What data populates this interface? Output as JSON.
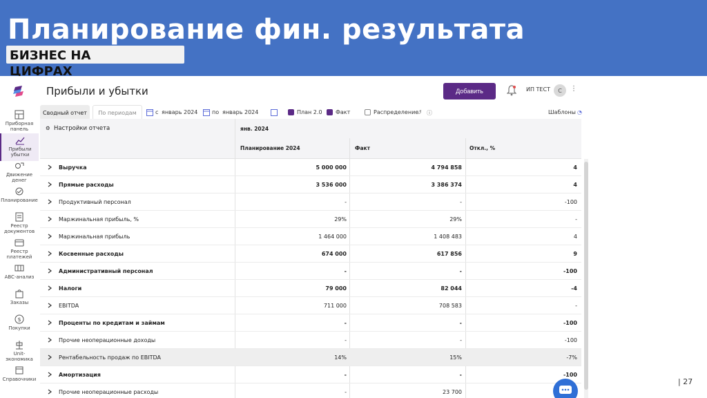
{
  "slide": {
    "title": "Планирование фин. результата",
    "badge": "БИЗНЕС НА ЦИФРАХ",
    "page_number": "| 27"
  },
  "colors": {
    "banner": "#4472c4",
    "accent": "#5b2a86",
    "chat": "#2f6fd6"
  },
  "app": {
    "page_title": "Прибыли и убытки",
    "add_button": "Добавить",
    "user_name": "ИП ТЕСТ",
    "avatar_letter": "С",
    "more": "⋮"
  },
  "sidebar": {
    "items": [
      {
        "label": "Приборная панель",
        "icon": "dashboard-icon",
        "active": false
      },
      {
        "label": "Прибыли убытки",
        "icon": "chart-icon",
        "active": true
      },
      {
        "label": "Движение денег",
        "icon": "money-flow-icon",
        "active": false
      },
      {
        "label": "Планирование",
        "icon": "planning-icon",
        "active": false
      },
      {
        "label": "Реестр документов",
        "icon": "document-icon",
        "active": false
      },
      {
        "label": "Реестр платежей",
        "icon": "wallet-icon",
        "active": false
      },
      {
        "label": "ABC-анализ",
        "icon": "abc-icon",
        "active": false
      },
      {
        "label": "Заказы",
        "icon": "bag-icon",
        "active": false
      },
      {
        "label": "Покупки",
        "icon": "dollar-icon",
        "active": false
      },
      {
        "label": "Unit-экономика",
        "icon": "unit-icon",
        "active": false
      },
      {
        "label": "Справочники",
        "icon": "book-icon",
        "active": false
      }
    ]
  },
  "toolbar": {
    "tab_summary": "Сводный отчет",
    "tab_periods": "По периодам",
    "from_label": "с",
    "from_date": "январь 2024",
    "to_label": "по",
    "to_date": "январь 2024",
    "plan_label": "План 2.0",
    "fact_label": "Факт",
    "distribution_label": "Распределение",
    "templates_label": "Шаблоны"
  },
  "table": {
    "settings_label": "Настройки отчета",
    "period_header": "янв. 2024",
    "columns": [
      "Планирование 2024",
      "Факт",
      "Откл., %"
    ],
    "rows": [
      {
        "name": "Выручка",
        "plan": "5 000 000",
        "fact": "4 794 858",
        "dev": "4",
        "bold": true,
        "shaded": false
      },
      {
        "name": "Прямые расходы",
        "plan": "3 536 000",
        "fact": "3 386 374",
        "dev": "4",
        "bold": true,
        "shaded": false
      },
      {
        "name": "Продуктивный персонал",
        "plan": "-",
        "fact": "-",
        "dev": "-100",
        "bold": false,
        "shaded": false
      },
      {
        "name": "Маржинальная прибыль, %",
        "plan": "29%",
        "fact": "29%",
        "dev": "-",
        "bold": false,
        "shaded": false
      },
      {
        "name": "Маржинальная прибыль",
        "plan": "1 464 000",
        "fact": "1 408 483",
        "dev": "4",
        "bold": false,
        "shaded": false
      },
      {
        "name": "Косвенные расходы",
        "plan": "674 000",
        "fact": "617 856",
        "dev": "9",
        "bold": true,
        "shaded": false
      },
      {
        "name": "Административный персонал",
        "plan": "-",
        "fact": "-",
        "dev": "-100",
        "bold": true,
        "shaded": false
      },
      {
        "name": "Налоги",
        "plan": "79 000",
        "fact": "82 044",
        "dev": "-4",
        "bold": true,
        "shaded": false
      },
      {
        "name": "EBITDA",
        "plan": "711 000",
        "fact": "708 583",
        "dev": "-",
        "bold": false,
        "shaded": false
      },
      {
        "name": "Проценты по кредитам и займам",
        "plan": "-",
        "fact": "-",
        "dev": "-100",
        "bold": true,
        "shaded": false
      },
      {
        "name": "Прочие неоперационные доходы",
        "plan": "-",
        "fact": "-",
        "dev": "-100",
        "bold": false,
        "shaded": false
      },
      {
        "name": "Рентабельность продаж по EBITDA",
        "plan": "14%",
        "fact": "15%",
        "dev": "-7%",
        "bold": false,
        "shaded": true
      },
      {
        "name": "Амортизация",
        "plan": "-",
        "fact": "-",
        "dev": "-100",
        "bold": true,
        "shaded": false
      },
      {
        "name": "Прочие неоперационные расходы",
        "plan": "-",
        "fact": "23 700",
        "dev": "",
        "bold": false,
        "shaded": false
      }
    ]
  }
}
